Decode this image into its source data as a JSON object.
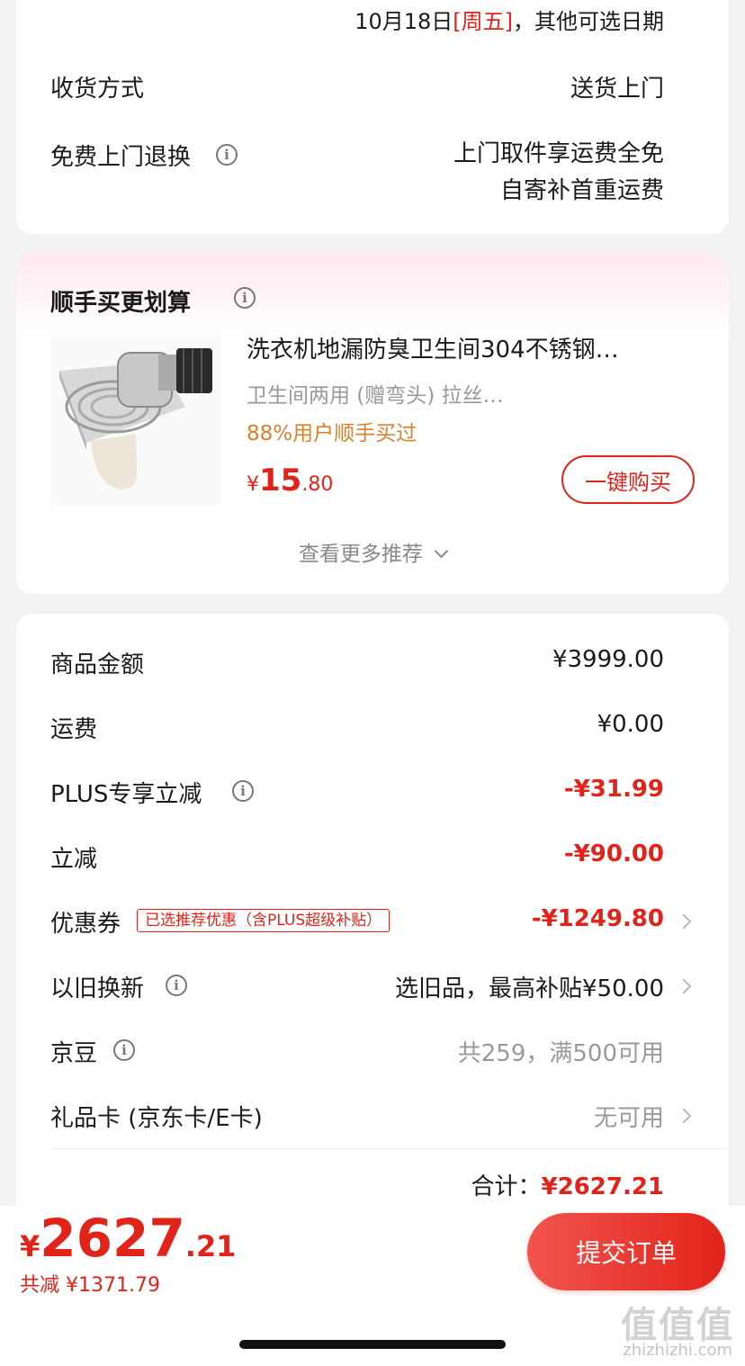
{
  "delivery": {
    "date_prefix": "10月18日",
    "weekday": "[周五]",
    "date_suffix": "，其他可选日期",
    "receive_label": "收货方式",
    "receive_value": "送货上门",
    "return_label": "免费上门退换",
    "return_value_1": "上门取件享运费全免",
    "return_value_2": "自寄补首重运费"
  },
  "recommend": {
    "title": "顺手买更划算",
    "product_name": "洗衣机地漏防臭卫生间304不锈钢…",
    "product_spec": "卫生间两用 (赠弯头) 拉丝…",
    "social_proof": "88%用户顺手买过",
    "price_symbol": "¥",
    "price_int": "15",
    "price_dec": ".80",
    "buy_button": "一键购买",
    "more_link": "查看更多推荐"
  },
  "summary": {
    "rows": [
      {
        "label": "商品金额",
        "value": "¥3999.00"
      },
      {
        "label": "运费",
        "value": "¥0.00"
      },
      {
        "label": "PLUS专享立减",
        "value": "-¥31.99"
      },
      {
        "label": "立减",
        "value": "-¥90.00"
      },
      {
        "label": "优惠券",
        "tag": "已选推荐优惠（含PLUS超级补贴）",
        "value": "-¥1249.80"
      },
      {
        "label": "以旧换新",
        "value": "选旧品，最高补贴¥50.00"
      },
      {
        "label": "京豆",
        "value": "共259，满500可用"
      },
      {
        "label": "礼品卡 (京东卡/E卡)",
        "value": "无可用"
      }
    ],
    "total_label": "合计：",
    "total_value": "¥2627.21"
  },
  "footer": {
    "price_symbol": "¥",
    "price_int": "2627",
    "price_dec": ".21",
    "savings": "共减 ¥1371.79",
    "submit_button": "提交订单"
  },
  "watermark": {
    "logo_text": "值值值",
    "url": "zhizhizhi.com"
  },
  "colors": {
    "accent": "#e2231a",
    "social_proof": "#d9822b"
  }
}
